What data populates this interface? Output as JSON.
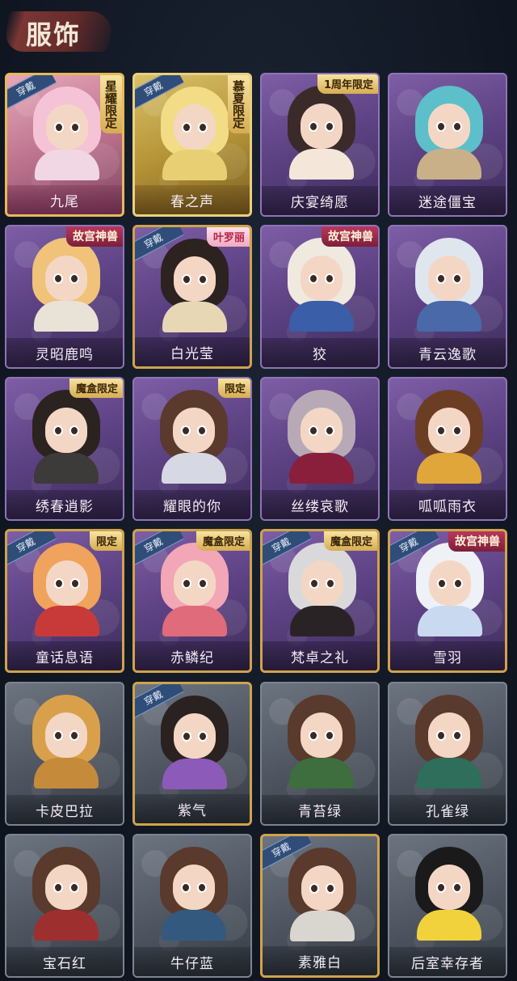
{
  "header": {
    "title": "服饰"
  },
  "labels": {
    "equipped": "穿戴"
  },
  "items": [
    {
      "name": "九尾",
      "tag": "星耀限定",
      "equipped": true,
      "frame": "pink",
      "hair": "#f4c3d6",
      "outfit": "#f0d7e3"
    },
    {
      "name": "春之声",
      "tag": "慕夏限定",
      "equipped": true,
      "frame": "gold",
      "hair": "#f2dc86",
      "outfit": "#e8cf74"
    },
    {
      "name": "庆宴绮愿",
      "tag": "1周年限定",
      "equipped": false,
      "frame": "purple",
      "hair": "#3b2a2a",
      "outfit": "#f4e6d8"
    },
    {
      "name": "迷途僵宝",
      "tag": "",
      "equipped": false,
      "frame": "purple",
      "hair": "#5cbfc9",
      "outfit": "#c9b089"
    },
    {
      "name": "灵昭鹿鸣",
      "tag": "故宫神兽",
      "equipped": false,
      "frame": "purple",
      "hair": "#f0c27a",
      "outfit": "#e9e2d6"
    },
    {
      "name": "白光莹",
      "tag": "叶罗丽",
      "equipped": true,
      "frame": "purple",
      "hair": "#2c2220",
      "outfit": "#e8d7b4"
    },
    {
      "name": "狡",
      "tag": "故宫神兽",
      "equipped": false,
      "frame": "purple",
      "hair": "#efe9e0",
      "outfit": "#3b5ea8"
    },
    {
      "name": "青云逸歌",
      "tag": "",
      "equipped": false,
      "frame": "purple",
      "hair": "#dfe6ee",
      "outfit": "#4a69a8"
    },
    {
      "name": "绣春逍影",
      "tag": "魔盒限定",
      "equipped": false,
      "frame": "purple",
      "hair": "#2a2320",
      "outfit": "#3d3a3a"
    },
    {
      "name": "耀眼的你",
      "tag": "限定",
      "equipped": false,
      "frame": "purple",
      "hair": "#5a3a2c",
      "outfit": "#d6d9e4"
    },
    {
      "name": "丝缕哀歌",
      "tag": "",
      "equipped": false,
      "frame": "purple",
      "hair": "#b7aab6",
      "outfit": "#8a1f3c"
    },
    {
      "name": "呱呱雨衣",
      "tag": "",
      "equipped": false,
      "frame": "purple",
      "hair": "#6b3e24",
      "outfit": "#e0a63a"
    },
    {
      "name": "童话息语",
      "tag": "限定",
      "equipped": true,
      "frame": "purple",
      "hair": "#f0a35c",
      "outfit": "#c83a3a"
    },
    {
      "name": "赤鳞纪",
      "tag": "魔盒限定",
      "equipped": true,
      "frame": "purple",
      "hair": "#f2a6b6",
      "outfit": "#e06b7a"
    },
    {
      "name": "梵卓之礼",
      "tag": "魔盒限定",
      "equipped": true,
      "frame": "purple",
      "hair": "#d9d9dc",
      "outfit": "#2a2326"
    },
    {
      "name": "雪羽",
      "tag": "故宫神兽",
      "equipped": true,
      "frame": "purple",
      "hair": "#eef1f6",
      "outfit": "#c9d9f0"
    },
    {
      "name": "卡皮巴拉",
      "tag": "",
      "equipped": false,
      "frame": "gray",
      "hair": "#d9a04c",
      "outfit": "#c58a3a"
    },
    {
      "name": "紫气",
      "tag": "",
      "equipped": true,
      "frame": "gray",
      "hair": "#2a2220",
      "outfit": "#8c5ab8"
    },
    {
      "name": "青苔绿",
      "tag": "",
      "equipped": false,
      "frame": "gray",
      "hair": "#5a3a2c",
      "outfit": "#3e6e3e"
    },
    {
      "name": "孔雀绿",
      "tag": "",
      "equipped": false,
      "frame": "gray",
      "hair": "#5a3a2c",
      "outfit": "#2e6e5a"
    },
    {
      "name": "宝石红",
      "tag": "",
      "equipped": false,
      "frame": "gray",
      "hair": "#5a3a2c",
      "outfit": "#9e2f2f"
    },
    {
      "name": "牛仔蓝",
      "tag": "",
      "equipped": false,
      "frame": "gray",
      "hair": "#5a3a2c",
      "outfit": "#34597e"
    },
    {
      "name": "素雅白",
      "tag": "",
      "equipped": true,
      "frame": "gray",
      "hair": "#5a3a2c",
      "outfit": "#d9d6cf"
    },
    {
      "name": "后室幸存者",
      "tag": "",
      "equipped": false,
      "frame": "gray",
      "hair": "#1a1a1a",
      "outfit": "#f2d23c"
    }
  ]
}
